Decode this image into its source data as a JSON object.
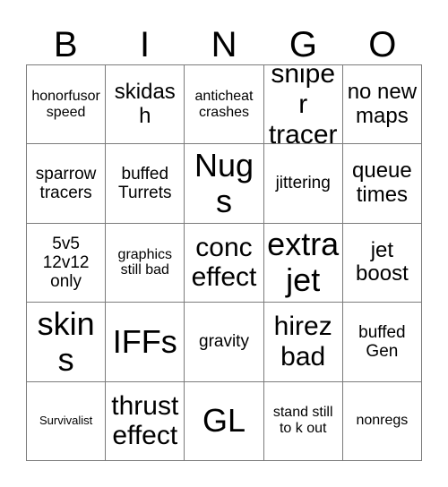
{
  "card": {
    "title": "BINGO",
    "header_letters": [
      "B",
      "I",
      "N",
      "G",
      "O"
    ],
    "grid_colors": {
      "background": "#ffffff",
      "border": "#7b7b7b",
      "text": "#000000"
    },
    "rows": [
      [
        {
          "text": "honorfusor speed",
          "size": "fs-s"
        },
        {
          "text": "skidash",
          "size": "fs-l"
        },
        {
          "text": "anticheat crashes",
          "size": "fs-s"
        },
        {
          "text": "sniper tracer",
          "size": "fs-xl"
        },
        {
          "text": "no new maps",
          "size": "fs-l"
        }
      ],
      [
        {
          "text": "sparrow tracers",
          "size": "fs-m"
        },
        {
          "text": "buffed Turrets",
          "size": "fs-m"
        },
        {
          "text": "Nugs",
          "size": "fs-xxl"
        },
        {
          "text": "jittering",
          "size": "fs-m"
        },
        {
          "text": "queue times",
          "size": "fs-l"
        }
      ],
      [
        {
          "text": "5v5 12v12 only",
          "size": "fs-m"
        },
        {
          "text": "graphics still bad",
          "size": "fs-s"
        },
        {
          "text": "conc effect",
          "size": "fs-xl"
        },
        {
          "text": "extra jet",
          "size": "fs-xxl"
        },
        {
          "text": "jet boost",
          "size": "fs-l"
        }
      ],
      [
        {
          "text": "skins",
          "size": "fs-xxl"
        },
        {
          "text": "IFFs",
          "size": "fs-xxl"
        },
        {
          "text": "gravity",
          "size": "fs-m"
        },
        {
          "text": "hirez bad",
          "size": "fs-xl"
        },
        {
          "text": "buffed Gen",
          "size": "fs-m"
        }
      ],
      [
        {
          "text": "Survivalist",
          "size": "fs-xs"
        },
        {
          "text": "thrust effect",
          "size": "fs-xl"
        },
        {
          "text": "GL",
          "size": "fs-xxl"
        },
        {
          "text": "stand still to k out",
          "size": "fs-s"
        },
        {
          "text": "nonregs",
          "size": "fs-s"
        }
      ]
    ]
  }
}
